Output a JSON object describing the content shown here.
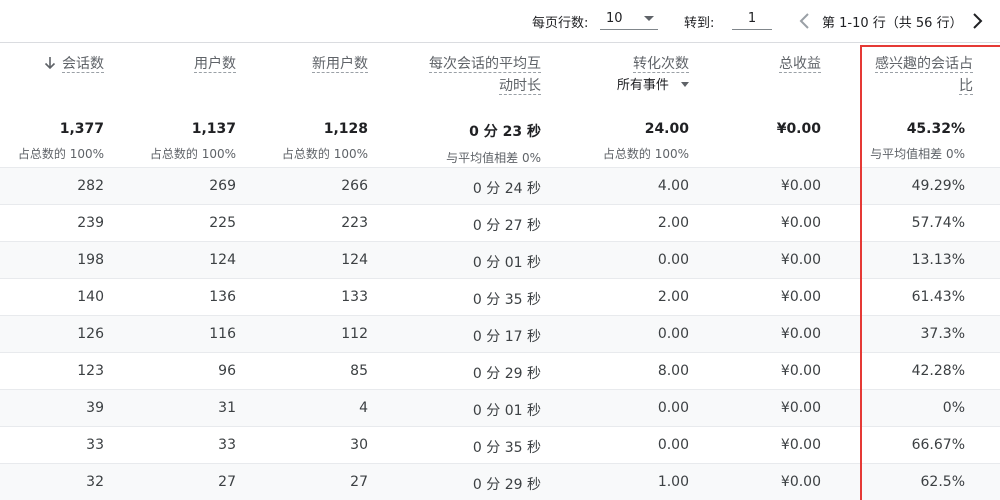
{
  "pager": {
    "rows_per_page_label": "每页行数:",
    "rows_per_page_value": "10",
    "goto_label": "转到:",
    "goto_value": "1",
    "range_text": "第 1-10 行（共 56 行）"
  },
  "columns": [
    {
      "label": "会话数"
    },
    {
      "label": "用户数"
    },
    {
      "label": "新用户数"
    },
    {
      "label_line1": "每次会话的平均互",
      "label_line2": "动时长"
    },
    {
      "label": "转化次数",
      "sub": "所有事件"
    },
    {
      "label": "总收益"
    },
    {
      "label_line1": "感兴趣的会话占",
      "label_line2": "比"
    }
  ],
  "totals": [
    {
      "value": "1,377",
      "note": "占总数的 100%"
    },
    {
      "value": "1,137",
      "note": "占总数的 100%"
    },
    {
      "value": "1,128",
      "note": "占总数的 100%"
    },
    {
      "value": "0 分 23 秒",
      "note": "与平均值相差 0%"
    },
    {
      "value": "24.00",
      "note": "占总数的 100%"
    },
    {
      "value": "¥0.00",
      "note": ""
    },
    {
      "value": "45.32%",
      "note": "与平均值相差 0%"
    }
  ],
  "rows": [
    [
      "282",
      "269",
      "266",
      "0 分 24 秒",
      "4.00",
      "¥0.00",
      "49.29%"
    ],
    [
      "239",
      "225",
      "223",
      "0 分 27 秒",
      "2.00",
      "¥0.00",
      "57.74%"
    ],
    [
      "198",
      "124",
      "124",
      "0 分 01 秒",
      "0.00",
      "¥0.00",
      "13.13%"
    ],
    [
      "140",
      "136",
      "133",
      "0 分 35 秒",
      "2.00",
      "¥0.00",
      "61.43%"
    ],
    [
      "126",
      "116",
      "112",
      "0 分 17 秒",
      "0.00",
      "¥0.00",
      "37.3%"
    ],
    [
      "123",
      "96",
      "85",
      "0 分 29 秒",
      "8.00",
      "¥0.00",
      "42.28%"
    ],
    [
      "39",
      "31",
      "4",
      "0 分 01 秒",
      "0.00",
      "¥0.00",
      "0%"
    ],
    [
      "33",
      "33",
      "30",
      "0 分 35 秒",
      "0.00",
      "¥0.00",
      "66.67%"
    ],
    [
      "32",
      "27",
      "27",
      "0 分 29 秒",
      "1.00",
      "¥0.00",
      "62.5%"
    ]
  ],
  "icons": {
    "sort": "arrow-down-icon",
    "dropdown": "caret-down-icon",
    "prev": "chevron-left-icon",
    "next": "chevron-right-icon"
  },
  "colors": {
    "highlight": "#e53935"
  }
}
